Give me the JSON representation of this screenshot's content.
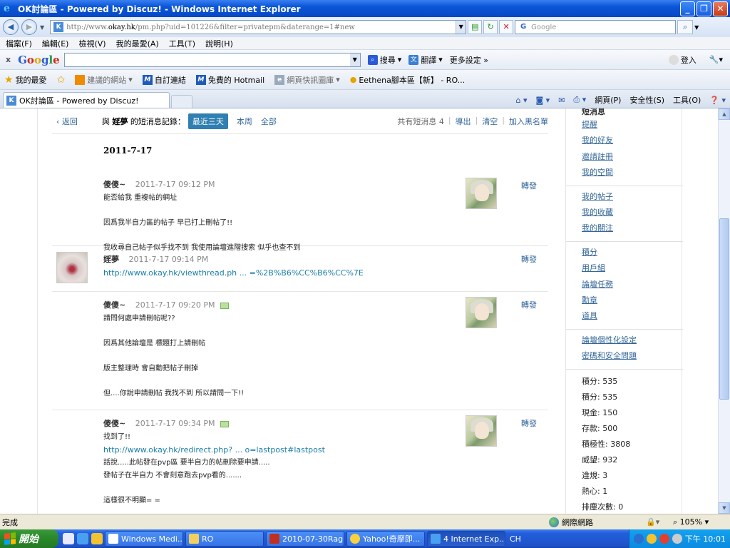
{
  "window": {
    "title": "OK討論區 - Powered by Discuz! - Windows Internet Explorer"
  },
  "addressbar": {
    "url_prefix": "http://www.",
    "url_domain": "okay.hk",
    "url_rest": "/pm.php?uid=101226&filter=privatepm&daterange=1#new",
    "search_placeholder": "Google"
  },
  "menubar": [
    "檔案(F)",
    "編輯(E)",
    "檢視(V)",
    "我的最愛(A)",
    "工具(T)",
    "說明(H)"
  ],
  "google_toolbar": {
    "logo": "Google",
    "search_label": "搜尋",
    "translate_label": "翻譯",
    "more_label": "更多設定 »",
    "login_label": "登入"
  },
  "favorites_bar": {
    "favorites": "我的最愛",
    "suggested": "建議的網站",
    "custom_links": "自訂連結",
    "hotmail": "免費的 Hotmail",
    "web_slice": "網頁快訊圖庫",
    "ethena": "Eethena腳本區【新】 - RO..."
  },
  "tab": {
    "title": "OK討論區 - Powered by Discuz!"
  },
  "commandbar": {
    "page": "網頁(P)",
    "safety": "安全性(S)",
    "tools": "工具(O)"
  },
  "pm": {
    "back": "返回",
    "with_prefix": "與",
    "with_user": "婬夢",
    "with_suffix": "的短消息記錄：",
    "tabs": [
      "最近三天",
      "本周",
      "全部"
    ],
    "count_text": "共有短消息 4",
    "export": "導出",
    "clear": "清空",
    "blacklist": "加入黑名單",
    "date": "2011-7-17",
    "forward_label": "轉發",
    "messages": [
      {
        "author": "傻傻~",
        "time": "2011-7-17 09:12 PM",
        "lines": [
          "能否給我 重複帖的網址",
          "",
          "因爲我半自力區的帖子 早已打上刪帖了!!",
          "",
          "我收尋自己帖子似乎找不到 我使用論壇進階搜索 似乎也查不到"
        ]
      },
      {
        "author": "婬夢",
        "time": "2011-7-17 09:14 PM",
        "link": "http://www.okay.hk/viewthread.ph ... =%2B%B6%CC%B6%CC%7E"
      },
      {
        "author": "傻傻~",
        "time": "2011-7-17 09:20 PM",
        "lines": [
          "請問何處申請刪帖呢??",
          "",
          "因爲其他論壇是 標題打上請刪帖",
          "",
          "版主整理時 會自動把帖子刪掉",
          "",
          "但....你說申請刪帖 我找不到 所以請問一下!!"
        ]
      },
      {
        "author": "傻傻~",
        "time": "2011-7-17 09:34 PM",
        "line1": "找到了!!",
        "link": "http://www.okay.hk/redirect.php? ... o=lastpost#lastpost",
        "lines": [
          "話說.....此帖發在pvp區 要半自力的帖刪除要申請.....",
          "發帖子在半自力 不會刻意跑去pvp看的.......",
          "",
          "這樣很不明顯= ="
        ]
      }
    ]
  },
  "sidebar": {
    "heading": "短消息",
    "group1": [
      "提醒",
      "我的好友",
      "邀請註冊",
      "我的空間"
    ],
    "group2": [
      "我的帖子",
      "我的收藏",
      "我的關注"
    ],
    "group3": [
      "積分",
      "用戶組",
      "論壇任務",
      "勳章",
      "道具"
    ],
    "group4": [
      "論壇個性化設定",
      "密碼和安全問題"
    ],
    "stats": [
      "積分: 535",
      "積分: 535",
      "現金: 150",
      "存款: 500",
      "積極性: 3808",
      "威望: 932",
      "違規: 3",
      "熱心: 1",
      "排塵次數: 0"
    ]
  },
  "statusbar": {
    "status": "完成",
    "zone": "網際網路",
    "zoom": "105%"
  },
  "taskbar": {
    "start": "開始",
    "tasks": [
      "Windows Medi...",
      "RO",
      "2010-07-30Rag...",
      "Yahoo!奇摩即...",
      "4 Internet Exp..."
    ],
    "lang": "CH",
    "clock": "下午 10:01"
  }
}
